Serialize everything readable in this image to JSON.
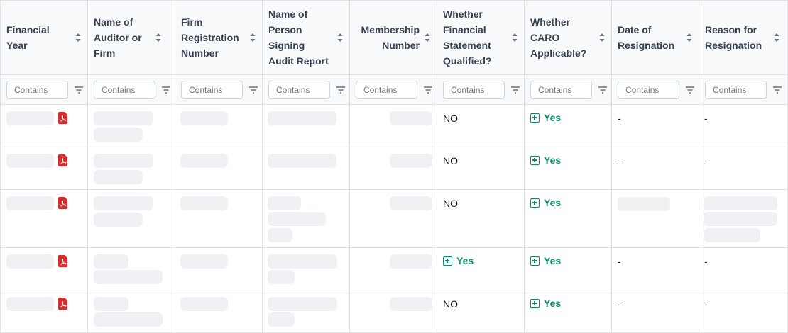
{
  "columns": [
    {
      "label": "Financial Year"
    },
    {
      "label": "Name of Auditor or Firm"
    },
    {
      "label": "Firm Registration Number"
    },
    {
      "label": "Name of Person Signing Audit Report"
    },
    {
      "label": "Membership Number"
    },
    {
      "label": "Whether Financial Statement Qualified?"
    },
    {
      "label": "Whether CARO Applicable?"
    },
    {
      "label": "Date of Resignation"
    },
    {
      "label": "Reason for Resignation"
    }
  ],
  "filter_placeholder": "Contains",
  "rows": [
    {
      "qualified": "NO",
      "caro": "Yes",
      "date": "-",
      "reason": "-"
    },
    {
      "qualified": "NO",
      "caro": "Yes",
      "date": "-",
      "reason": "-"
    },
    {
      "qualified": "NO",
      "caro": "Yes"
    },
    {
      "qualified": "Yes",
      "caro": "Yes",
      "date": "-",
      "reason": "-"
    },
    {
      "qualified": "NO",
      "caro": "Yes",
      "date": "-",
      "reason": "-"
    }
  ],
  "colors": {
    "accent_green": "#0d8a6a",
    "pdf_red": "#d32f2f",
    "skeleton": "#f0f1f4"
  }
}
